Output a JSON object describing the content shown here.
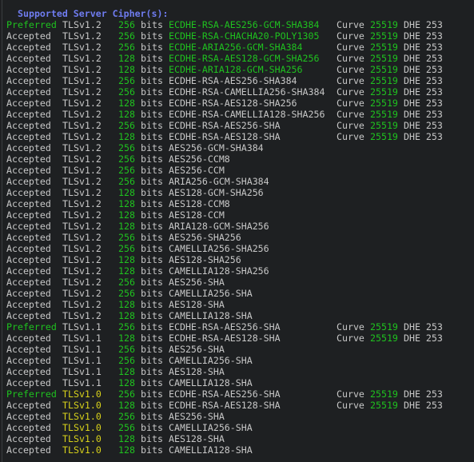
{
  "heading": "Supported Server Cipher(s):",
  "colors": {
    "background": "#1e2022",
    "text": "#c8c8c8",
    "heading": "#6f7cf0",
    "good": "#1fc21f",
    "warning": "#d8d21a"
  },
  "rows": [
    {
      "status": "Preferred",
      "status_color": "green",
      "protocol": "TLSv1.2",
      "protocol_color": "grey",
      "bits": "256",
      "bits_label": "bits",
      "cipher": "ECDHE-RSA-AES256-GCM-SHA384",
      "cipher_color": "green",
      "curve_label": "Curve",
      "curve": "25519",
      "dhe": "DHE 253"
    },
    {
      "status": "Accepted",
      "status_color": "grey",
      "protocol": "TLSv1.2",
      "protocol_color": "grey",
      "bits": "256",
      "bits_label": "bits",
      "cipher": "ECDHE-RSA-CHACHA20-POLY1305",
      "cipher_color": "green",
      "curve_label": "Curve",
      "curve": "25519",
      "dhe": "DHE 253"
    },
    {
      "status": "Accepted",
      "status_color": "grey",
      "protocol": "TLSv1.2",
      "protocol_color": "grey",
      "bits": "256",
      "bits_label": "bits",
      "cipher": "ECDHE-ARIA256-GCM-SHA384",
      "cipher_color": "green",
      "curve_label": "Curve",
      "curve": "25519",
      "dhe": "DHE 253"
    },
    {
      "status": "Accepted",
      "status_color": "grey",
      "protocol": "TLSv1.2",
      "protocol_color": "grey",
      "bits": "128",
      "bits_label": "bits",
      "cipher": "ECDHE-RSA-AES128-GCM-SHA256",
      "cipher_color": "green",
      "curve_label": "Curve",
      "curve": "25519",
      "dhe": "DHE 253"
    },
    {
      "status": "Accepted",
      "status_color": "grey",
      "protocol": "TLSv1.2",
      "protocol_color": "grey",
      "bits": "128",
      "bits_label": "bits",
      "cipher": "ECDHE-ARIA128-GCM-SHA256",
      "cipher_color": "green",
      "curve_label": "Curve",
      "curve": "25519",
      "dhe": "DHE 253"
    },
    {
      "status": "Accepted",
      "status_color": "grey",
      "protocol": "TLSv1.2",
      "protocol_color": "grey",
      "bits": "256",
      "bits_label": "bits",
      "cipher": "ECDHE-RSA-AES256-SHA384",
      "cipher_color": "grey",
      "curve_label": "Curve",
      "curve": "25519",
      "dhe": "DHE 253"
    },
    {
      "status": "Accepted",
      "status_color": "grey",
      "protocol": "TLSv1.2",
      "protocol_color": "grey",
      "bits": "256",
      "bits_label": "bits",
      "cipher": "ECDHE-RSA-CAMELLIA256-SHA384",
      "cipher_color": "grey",
      "curve_label": "Curve",
      "curve": "25519",
      "dhe": "DHE 253"
    },
    {
      "status": "Accepted",
      "status_color": "grey",
      "protocol": "TLSv1.2",
      "protocol_color": "grey",
      "bits": "128",
      "bits_label": "bits",
      "cipher": "ECDHE-RSA-AES128-SHA256",
      "cipher_color": "grey",
      "curve_label": "Curve",
      "curve": "25519",
      "dhe": "DHE 253"
    },
    {
      "status": "Accepted",
      "status_color": "grey",
      "protocol": "TLSv1.2",
      "protocol_color": "grey",
      "bits": "128",
      "bits_label": "bits",
      "cipher": "ECDHE-RSA-CAMELLIA128-SHA256",
      "cipher_color": "grey",
      "curve_label": "Curve",
      "curve": "25519",
      "dhe": "DHE 253"
    },
    {
      "status": "Accepted",
      "status_color": "grey",
      "protocol": "TLSv1.2",
      "protocol_color": "grey",
      "bits": "256",
      "bits_label": "bits",
      "cipher": "ECDHE-RSA-AES256-SHA",
      "cipher_color": "grey",
      "curve_label": "Curve",
      "curve": "25519",
      "dhe": "DHE 253"
    },
    {
      "status": "Accepted",
      "status_color": "grey",
      "protocol": "TLSv1.2",
      "protocol_color": "grey",
      "bits": "128",
      "bits_label": "bits",
      "cipher": "ECDHE-RSA-AES128-SHA",
      "cipher_color": "grey",
      "curve_label": "Curve",
      "curve": "25519",
      "dhe": "DHE 253"
    },
    {
      "status": "Accepted",
      "status_color": "grey",
      "protocol": "TLSv1.2",
      "protocol_color": "grey",
      "bits": "256",
      "bits_label": "bits",
      "cipher": "AES256-GCM-SHA384",
      "cipher_color": "grey"
    },
    {
      "status": "Accepted",
      "status_color": "grey",
      "protocol": "TLSv1.2",
      "protocol_color": "grey",
      "bits": "256",
      "bits_label": "bits",
      "cipher": "AES256-CCM8",
      "cipher_color": "grey"
    },
    {
      "status": "Accepted",
      "status_color": "grey",
      "protocol": "TLSv1.2",
      "protocol_color": "grey",
      "bits": "256",
      "bits_label": "bits",
      "cipher": "AES256-CCM",
      "cipher_color": "grey"
    },
    {
      "status": "Accepted",
      "status_color": "grey",
      "protocol": "TLSv1.2",
      "protocol_color": "grey",
      "bits": "256",
      "bits_label": "bits",
      "cipher": "ARIA256-GCM-SHA384",
      "cipher_color": "grey"
    },
    {
      "status": "Accepted",
      "status_color": "grey",
      "protocol": "TLSv1.2",
      "protocol_color": "grey",
      "bits": "128",
      "bits_label": "bits",
      "cipher": "AES128-GCM-SHA256",
      "cipher_color": "grey"
    },
    {
      "status": "Accepted",
      "status_color": "grey",
      "protocol": "TLSv1.2",
      "protocol_color": "grey",
      "bits": "128",
      "bits_label": "bits",
      "cipher": "AES128-CCM8",
      "cipher_color": "grey"
    },
    {
      "status": "Accepted",
      "status_color": "grey",
      "protocol": "TLSv1.2",
      "protocol_color": "grey",
      "bits": "128",
      "bits_label": "bits",
      "cipher": "AES128-CCM",
      "cipher_color": "grey"
    },
    {
      "status": "Accepted",
      "status_color": "grey",
      "protocol": "TLSv1.2",
      "protocol_color": "grey",
      "bits": "128",
      "bits_label": "bits",
      "cipher": "ARIA128-GCM-SHA256",
      "cipher_color": "grey"
    },
    {
      "status": "Accepted",
      "status_color": "grey",
      "protocol": "TLSv1.2",
      "protocol_color": "grey",
      "bits": "256",
      "bits_label": "bits",
      "cipher": "AES256-SHA256",
      "cipher_color": "grey"
    },
    {
      "status": "Accepted",
      "status_color": "grey",
      "protocol": "TLSv1.2",
      "protocol_color": "grey",
      "bits": "256",
      "bits_label": "bits",
      "cipher": "CAMELLIA256-SHA256",
      "cipher_color": "grey"
    },
    {
      "status": "Accepted",
      "status_color": "grey",
      "protocol": "TLSv1.2",
      "protocol_color": "grey",
      "bits": "128",
      "bits_label": "bits",
      "cipher": "AES128-SHA256",
      "cipher_color": "grey"
    },
    {
      "status": "Accepted",
      "status_color": "grey",
      "protocol": "TLSv1.2",
      "protocol_color": "grey",
      "bits": "128",
      "bits_label": "bits",
      "cipher": "CAMELLIA128-SHA256",
      "cipher_color": "grey"
    },
    {
      "status": "Accepted",
      "status_color": "grey",
      "protocol": "TLSv1.2",
      "protocol_color": "grey",
      "bits": "256",
      "bits_label": "bits",
      "cipher": "AES256-SHA",
      "cipher_color": "grey"
    },
    {
      "status": "Accepted",
      "status_color": "grey",
      "protocol": "TLSv1.2",
      "protocol_color": "grey",
      "bits": "256",
      "bits_label": "bits",
      "cipher": "CAMELLIA256-SHA",
      "cipher_color": "grey"
    },
    {
      "status": "Accepted",
      "status_color": "grey",
      "protocol": "TLSv1.2",
      "protocol_color": "grey",
      "bits": "128",
      "bits_label": "bits",
      "cipher": "AES128-SHA",
      "cipher_color": "grey"
    },
    {
      "status": "Accepted",
      "status_color": "grey",
      "protocol": "TLSv1.2",
      "protocol_color": "grey",
      "bits": "128",
      "bits_label": "bits",
      "cipher": "CAMELLIA128-SHA",
      "cipher_color": "grey"
    },
    {
      "status": "Preferred",
      "status_color": "green",
      "protocol": "TLSv1.1",
      "protocol_color": "grey",
      "bits": "256",
      "bits_label": "bits",
      "cipher": "ECDHE-RSA-AES256-SHA",
      "cipher_color": "grey",
      "curve_label": "Curve",
      "curve": "25519",
      "dhe": "DHE 253"
    },
    {
      "status": "Accepted",
      "status_color": "grey",
      "protocol": "TLSv1.1",
      "protocol_color": "grey",
      "bits": "128",
      "bits_label": "bits",
      "cipher": "ECDHE-RSA-AES128-SHA",
      "cipher_color": "grey",
      "curve_label": "Curve",
      "curve": "25519",
      "dhe": "DHE 253"
    },
    {
      "status": "Accepted",
      "status_color": "grey",
      "protocol": "TLSv1.1",
      "protocol_color": "grey",
      "bits": "256",
      "bits_label": "bits",
      "cipher": "AES256-SHA",
      "cipher_color": "grey"
    },
    {
      "status": "Accepted",
      "status_color": "grey",
      "protocol": "TLSv1.1",
      "protocol_color": "grey",
      "bits": "256",
      "bits_label": "bits",
      "cipher": "CAMELLIA256-SHA",
      "cipher_color": "grey"
    },
    {
      "status": "Accepted",
      "status_color": "grey",
      "protocol": "TLSv1.1",
      "protocol_color": "grey",
      "bits": "128",
      "bits_label": "bits",
      "cipher": "AES128-SHA",
      "cipher_color": "grey"
    },
    {
      "status": "Accepted",
      "status_color": "grey",
      "protocol": "TLSv1.1",
      "protocol_color": "grey",
      "bits": "128",
      "bits_label": "bits",
      "cipher": "CAMELLIA128-SHA",
      "cipher_color": "grey"
    },
    {
      "status": "Preferred",
      "status_color": "green",
      "protocol": "TLSv1.0",
      "protocol_color": "yellow",
      "bits": "256",
      "bits_label": "bits",
      "cipher": "ECDHE-RSA-AES256-SHA",
      "cipher_color": "grey",
      "curve_label": "Curve",
      "curve": "25519",
      "dhe": "DHE 253"
    },
    {
      "status": "Accepted",
      "status_color": "grey",
      "protocol": "TLSv1.0",
      "protocol_color": "yellow",
      "bits": "128",
      "bits_label": "bits",
      "cipher": "ECDHE-RSA-AES128-SHA",
      "cipher_color": "grey",
      "curve_label": "Curve",
      "curve": "25519",
      "dhe": "DHE 253"
    },
    {
      "status": "Accepted",
      "status_color": "grey",
      "protocol": "TLSv1.0",
      "protocol_color": "yellow",
      "bits": "256",
      "bits_label": "bits",
      "cipher": "AES256-SHA",
      "cipher_color": "grey"
    },
    {
      "status": "Accepted",
      "status_color": "grey",
      "protocol": "TLSv1.0",
      "protocol_color": "yellow",
      "bits": "256",
      "bits_label": "bits",
      "cipher": "CAMELLIA256-SHA",
      "cipher_color": "grey"
    },
    {
      "status": "Accepted",
      "status_color": "grey",
      "protocol": "TLSv1.0",
      "protocol_color": "yellow",
      "bits": "128",
      "bits_label": "bits",
      "cipher": "AES128-SHA",
      "cipher_color": "grey"
    },
    {
      "status": "Accepted",
      "status_color": "grey",
      "protocol": "TLSv1.0",
      "protocol_color": "yellow",
      "bits": "128",
      "bits_label": "bits",
      "cipher": "CAMELLIA128-SHA",
      "cipher_color": "grey"
    }
  ]
}
